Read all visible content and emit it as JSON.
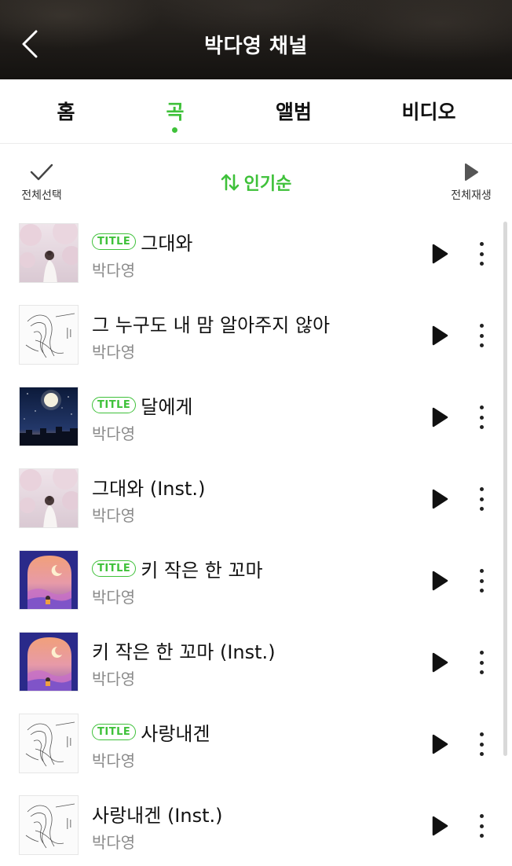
{
  "header": {
    "title": "박다영 채널",
    "back_icon": "chevron-left-icon"
  },
  "tabs": [
    {
      "label": "홈",
      "active": false
    },
    {
      "label": "곡",
      "active": true
    },
    {
      "label": "앨범",
      "active": false
    },
    {
      "label": "비디오",
      "active": false
    }
  ],
  "toolbar": {
    "select_all_label": "전체선택",
    "select_all_icon": "checkmark-icon",
    "sort_label": "인기순",
    "sort_icon": "sort-arrows-icon",
    "play_all_label": "전체재생",
    "play_all_icon": "play-icon"
  },
  "colors": {
    "accent": "#3fc13a",
    "header_bg": "#1e1b18"
  },
  "songs": [
    {
      "title": "그대와",
      "badge": "TITLE",
      "artist": "박다영",
      "art": "cherry-blossom-art"
    },
    {
      "title": "그 누구도 내 맘 알아주지 않아",
      "badge": "",
      "artist": "박다영",
      "art": "sketch-girl-art"
    },
    {
      "title": "달에게",
      "badge": "TITLE",
      "artist": "박다영",
      "art": "moon-night-art"
    },
    {
      "title": "그대와 (Inst.)",
      "badge": "",
      "artist": "박다영",
      "art": "cherry-blossom-art"
    },
    {
      "title": "키 작은 한 꼬마",
      "badge": "TITLE",
      "artist": "박다영",
      "art": "sunset-arch-art"
    },
    {
      "title": "키 작은 한 꼬마 (Inst.)",
      "badge": "",
      "artist": "박다영",
      "art": "sunset-arch-art"
    },
    {
      "title": "사랑내겐",
      "badge": "TITLE",
      "artist": "박다영",
      "art": "sketch-girl-art"
    },
    {
      "title": "사랑내겐 (Inst.)",
      "badge": "",
      "artist": "박다영",
      "art": "sketch-girl-art"
    }
  ]
}
